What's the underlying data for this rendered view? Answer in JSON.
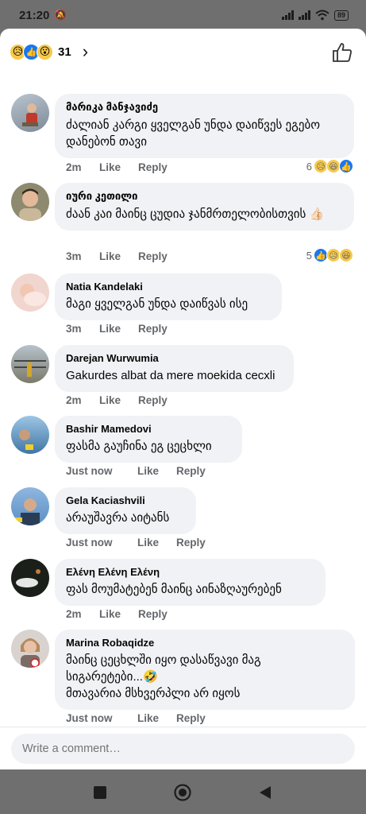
{
  "status_bar": {
    "time": "21:20",
    "battery": "89"
  },
  "header": {
    "reaction_count": "31",
    "reaction_icons": [
      "sad-face-icon",
      "like-icon",
      "wow-face-icon"
    ],
    "chevron": "›"
  },
  "comments": [
    {
      "author": "მარიკა მანჯავიძე",
      "text": "ძალიან კარგი ყველგან უნდა დაიწვეს ეგებო დანებონ თავი",
      "time": "2m",
      "like": "Like",
      "reply": "Reply",
      "reaction_count": "6",
      "reactions": [
        "sad",
        "haha",
        "like"
      ]
    },
    {
      "author": "იური კეთილი",
      "text": "ძაან კაი მაინც ცუდია ჯანმრთელობისთვის 👍🏻",
      "time": "3m",
      "like": "Like",
      "reply": "Reply",
      "reaction_count": "5",
      "reactions": [
        "like",
        "sad",
        "haha"
      ]
    },
    {
      "author": "Natia Kandelaki",
      "text": "მაგი ყველგან უნდა დაიწვას ისე",
      "time": "3m",
      "like": "Like",
      "reply": "Reply"
    },
    {
      "author": "Darejan Wurwumia",
      "text": "Gakurdes albat da mere moekida cecxli",
      "time": "2m",
      "like": "Like",
      "reply": "Reply"
    },
    {
      "author": "Bashir Mamedovi",
      "text": "ფასმა გაუჩინა ეგ ცეცხლი",
      "time": "Just now",
      "like": "Like",
      "reply": "Reply"
    },
    {
      "author": "Gela Kaciashvili",
      "text": "არაუშავრა აიტანს",
      "time": "Just now",
      "like": "Like",
      "reply": "Reply"
    },
    {
      "author": "Ελένη Ελένη Ελένη",
      "text": "ფას მოუმატებენ მაინც აინაზღაურებენ",
      "time": "2m",
      "like": "Like",
      "reply": "Reply"
    },
    {
      "author": "Marina Robaqidze",
      "text_lines": [
        "მაინც ცეცხლში იყო დასაწვავი მაგ",
        "სიგარეტები...🤣",
        "მთავარია მსხვერპლი არ იყოს"
      ],
      "time": "Just now",
      "like": "Like",
      "reply": "Reply"
    }
  ],
  "composer": {
    "placeholder": "Write a comment…"
  },
  "navbar": {
    "buttons": [
      "recent-apps-icon",
      "home-icon",
      "back-icon"
    ]
  },
  "colors": {
    "accent": "#1877f2",
    "bubble": "#f0f2f5",
    "meta": "#65676b",
    "system_bar": "#6f6f6f"
  }
}
